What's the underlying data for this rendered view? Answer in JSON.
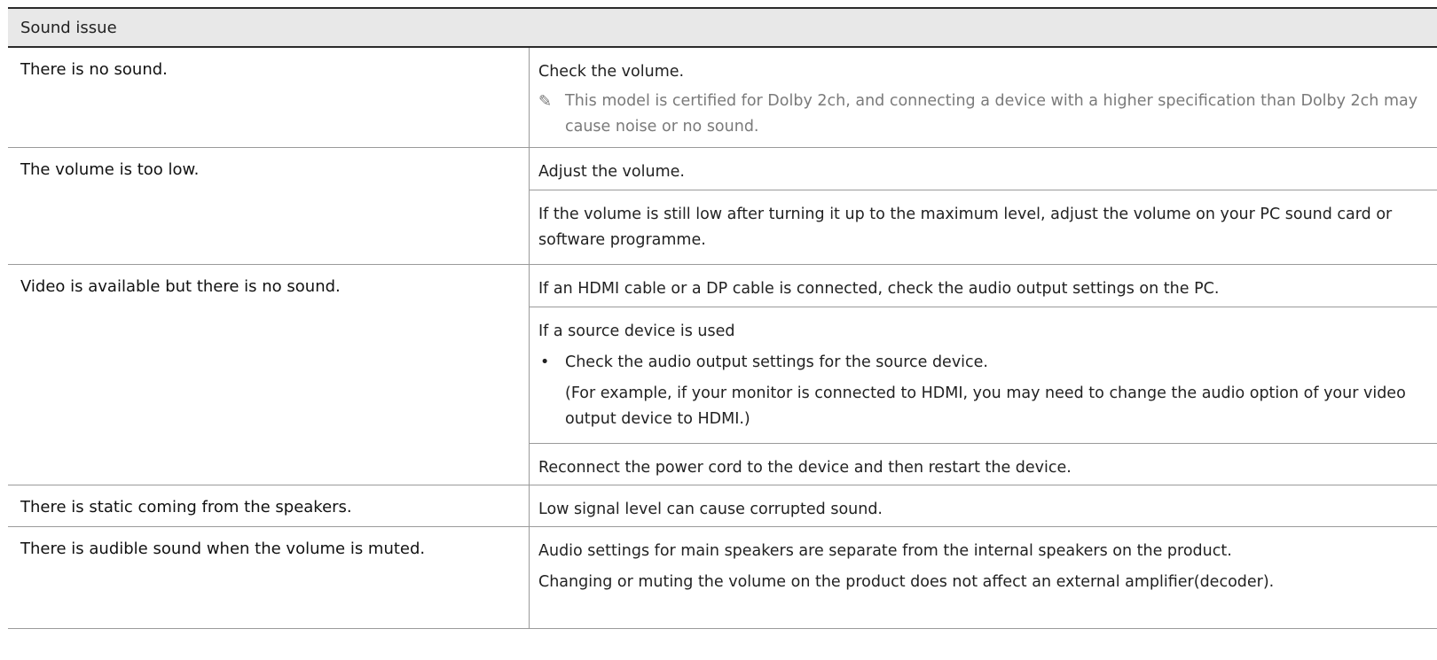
{
  "section_title": "Sound issue",
  "rows": [
    {
      "problem": "There is no sound.",
      "check_volume": "Check the volume.",
      "note": "This model is certified for Dolby 2ch, and connecting a device with a higher specification than Dolby 2ch may cause noise or no sound."
    },
    {
      "problem": "The volume is too low.",
      "adjust": "Adjust the volume.",
      "still_low": "If the volume is still low after turning it up to the maximum level, adjust the volume on your PC sound card or software programme."
    },
    {
      "problem": "Video is available but there is no sound.",
      "hdmi_dp": "If an HDMI cable or a DP cable is connected, check the audio output settings on the PC.",
      "source_used": "If a source device is used",
      "bullet": "Check the audio output settings for the source device.",
      "example": "(For example, if your monitor is connected to HDMI, you may need to change the audio option of your video output device to HDMI.)",
      "reconnect": "Reconnect the power cord to the device and then restart the device."
    },
    {
      "problem": "There is static coming from the speakers.",
      "low_signal": "Low signal level can cause corrupted sound."
    },
    {
      "problem": "There is audible sound when the volume is muted.",
      "separate": "Audio settings for main speakers are separate from the internal speakers on the product.",
      "external": "Changing or muting the volume on the product does not affect an external amplifier(decoder)."
    }
  ],
  "icons": {
    "note": "pencil-note-icon",
    "bullet": "bullet-dot"
  }
}
